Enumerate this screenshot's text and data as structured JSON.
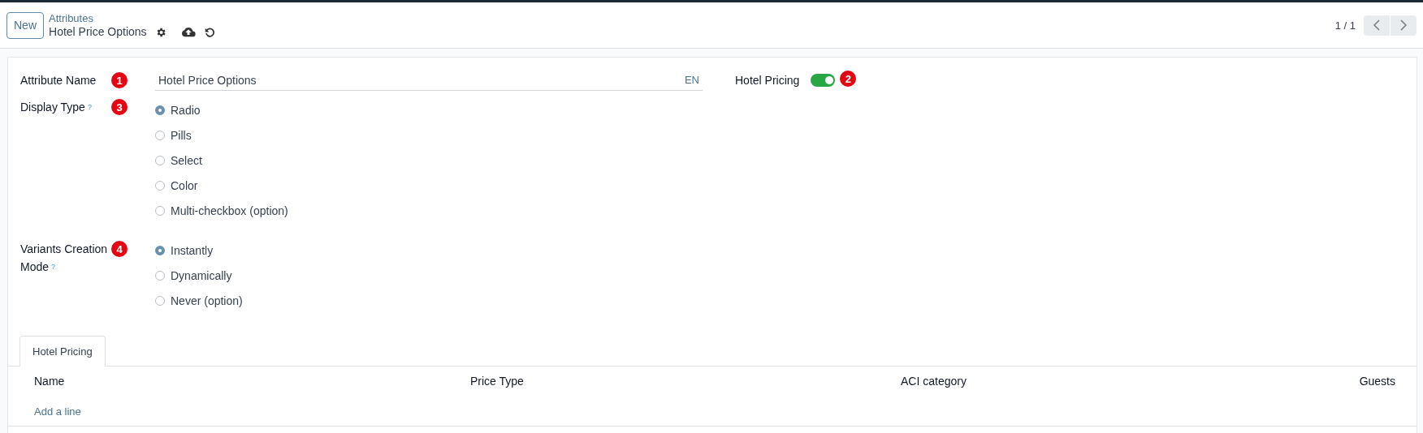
{
  "header": {
    "new_button": "New",
    "breadcrumb": "Attributes",
    "record_title": "Hotel Price Options",
    "pager": "1 / 1"
  },
  "form": {
    "attribute_name": {
      "label": "Attribute Name",
      "marker": "1",
      "value": "Hotel Price Options",
      "lang": "EN"
    },
    "hotel_pricing": {
      "label": "Hotel Pricing",
      "on": true,
      "marker": "2"
    },
    "display_type": {
      "label": "Display Type",
      "help": "?",
      "marker": "3",
      "options": [
        {
          "label": "Radio",
          "selected": true
        },
        {
          "label": "Pills",
          "selected": false
        },
        {
          "label": "Select",
          "selected": false
        },
        {
          "label": "Color",
          "selected": false
        },
        {
          "label": "Multi-checkbox (option)",
          "selected": false
        }
      ]
    },
    "variants_creation_mode": {
      "label": "Variants Creation Mode",
      "help": "?",
      "marker": "4",
      "options": [
        {
          "label": "Instantly",
          "selected": true
        },
        {
          "label": "Dynamically",
          "selected": false
        },
        {
          "label": "Never (option)",
          "selected": false
        }
      ]
    }
  },
  "tabs": [
    {
      "label": "Hotel Pricing",
      "selected": true
    }
  ],
  "table": {
    "columns": [
      "Name",
      "Price Type",
      "ACI category",
      "Guests"
    ],
    "add_line": "Add a line"
  }
}
